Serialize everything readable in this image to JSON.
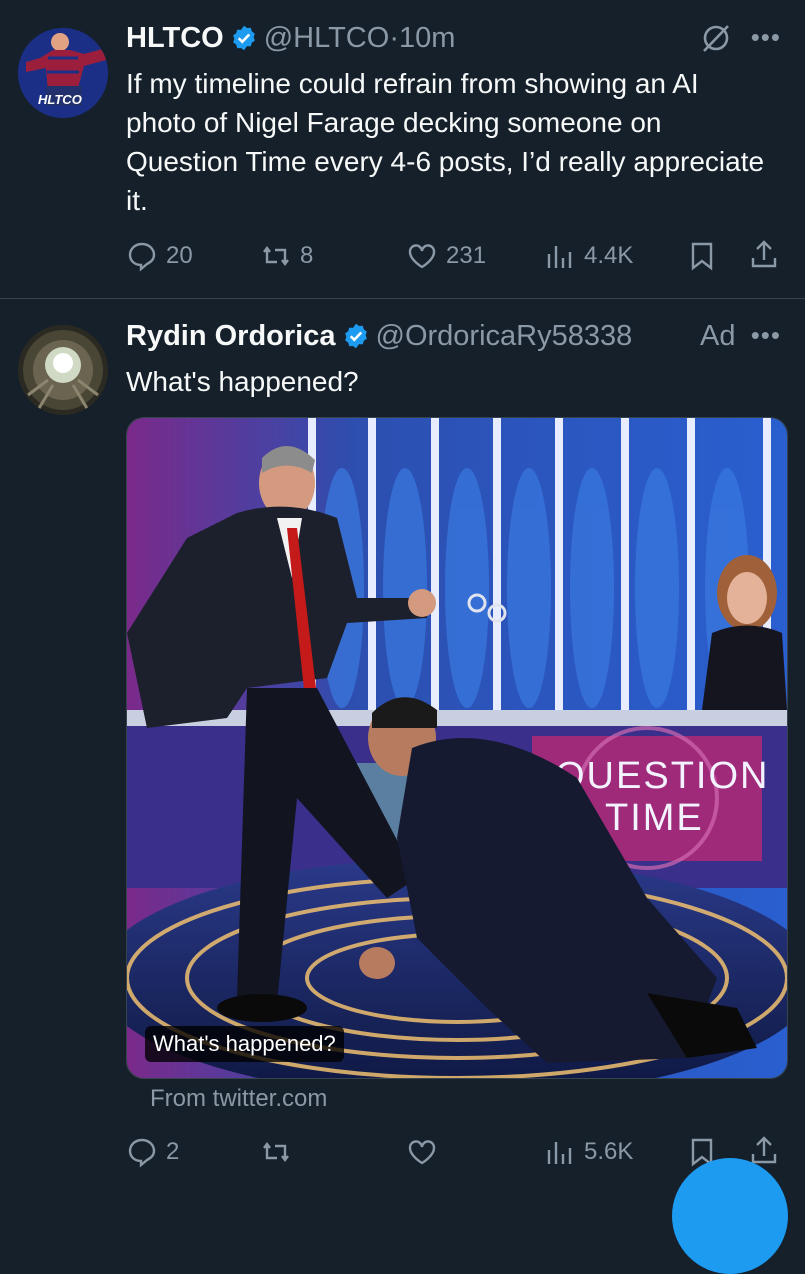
{
  "tweets": [
    {
      "name": "HLTCO",
      "handle": "@HLTCO",
      "time_sep": "·",
      "time": "10m",
      "text": "If my timeline could refrain from showing an AI photo of Nigel Farage decking someone on Question Time every 4-6 posts, I’d really appreciate it.",
      "avatar_text": "HLTCO",
      "actions": {
        "replies": "20",
        "reposts": "8",
        "likes": "231",
        "views": "4.4K"
      }
    },
    {
      "name": "Rydin Ordorica",
      "handle": "@OrdoricaRy58338",
      "ad_label": "Ad",
      "text": "What's happened?",
      "media_alt_badge": "What's happened?",
      "media_caption_words": [
        "QUESTION",
        "TIME"
      ],
      "link_source": "From twitter.com",
      "actions": {
        "replies": "2",
        "reposts": "",
        "likes": "",
        "views": "5.6K"
      }
    }
  ],
  "colors": {
    "background": "#15202b",
    "text": "#f7f9f9",
    "muted": "#8b98a5",
    "accent": "#1d9bf0",
    "separator": "#38444d"
  },
  "icons": [
    "verified-icon",
    "grok-icon",
    "more-icon",
    "reply-icon",
    "repost-icon",
    "like-icon",
    "views-icon",
    "bookmark-icon",
    "share-icon"
  ]
}
